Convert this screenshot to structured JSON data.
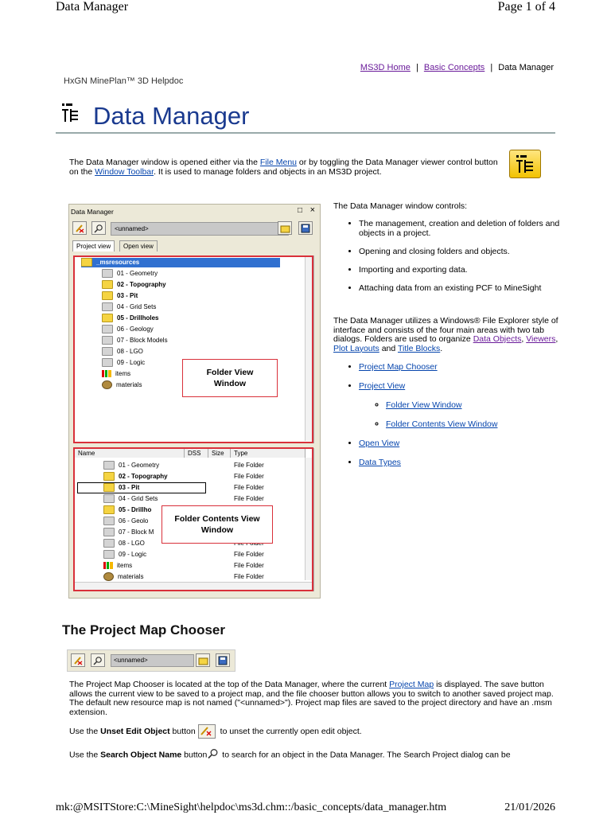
{
  "print": {
    "title": "Data Manager",
    "page": "Page 1 of 4",
    "footer_path": "mk:@MSITStore:C:\\MineSight\\helpdoc\\ms3d.chm::/basic_concepts/data_manager.htm",
    "footer_date": "21/01/2026"
  },
  "breadcrumb": {
    "home": "MS3D Home",
    "sep": "|",
    "basic": "Basic Concepts",
    "current": "Data Manager"
  },
  "helpdoc_title": "HxGN MinePlan™ 3D Helpdoc",
  "page_title": "Data Manager",
  "intro": {
    "t1": "The Data Manager window is opened either via the ",
    "file_menu": "File Menu",
    "t2": " or by toggling the Data Manager viewer control button on the ",
    "window_toolbar": "Window Toolbar",
    "t3": ".  It is used to manage folders and objects in an MS3D project."
  },
  "dm_window": {
    "title": "Data Manager",
    "combo": "<unnamed>",
    "tabs": [
      "Project view",
      "Open view"
    ],
    "tree": [
      {
        "label": "_msresources",
        "bold": true,
        "color": "y",
        "selected": true
      },
      {
        "label": "01 - Geometry",
        "bold": false,
        "color": "g"
      },
      {
        "label": "02 - Topography",
        "bold": true,
        "color": "y"
      },
      {
        "label": "03 - Pit",
        "bold": true,
        "color": "y"
      },
      {
        "label": "04 - Grid Sets",
        "bold": false,
        "color": "g"
      },
      {
        "label": "05 - Drillholes",
        "bold": true,
        "color": "y"
      },
      {
        "label": "06 - Geology",
        "bold": false,
        "color": "g"
      },
      {
        "label": "07 - Block Models",
        "bold": false,
        "color": "g"
      },
      {
        "label": "08 - LGO",
        "bold": false,
        "color": "g"
      },
      {
        "label": "09 - Logic",
        "bold": false,
        "color": "g"
      },
      {
        "label": "items",
        "bold": false,
        "color": "chart"
      },
      {
        "label": "materials",
        "bold": false,
        "color": "mat"
      }
    ],
    "folder_view_callout": "Folder View Window",
    "columns": [
      "Name",
      "DSS",
      "Size",
      "Type"
    ],
    "contents": [
      {
        "name": "01 - Geometry",
        "type": "File Folder",
        "bold": false,
        "color": "g"
      },
      {
        "name": "02 - Topography",
        "type": "File Folder",
        "bold": true,
        "color": "y"
      },
      {
        "name": "03 - Pit",
        "type": "File Folder",
        "bold": true,
        "color": "y"
      },
      {
        "name": "04 - Grid Sets",
        "type": "File Folder",
        "bold": false,
        "color": "g"
      },
      {
        "name": "05 - Drillho",
        "type": "File Folder",
        "bold": true,
        "color": "y"
      },
      {
        "name": "06 - Geolo",
        "type": "File Folder",
        "bold": false,
        "color": "g"
      },
      {
        "name": "07 - Block M",
        "type": "File Folder",
        "bold": false,
        "color": "g"
      },
      {
        "name": "08 - LGO",
        "type": "File Folder",
        "bold": false,
        "color": "g"
      },
      {
        "name": "09 - Logic",
        "type": "File Folder",
        "bold": false,
        "color": "g"
      },
      {
        "name": "items",
        "type": "File Folder",
        "bold": false,
        "color": "chart"
      },
      {
        "name": "materials",
        "type": "File Folder",
        "bold": false,
        "color": "mat"
      }
    ],
    "folder_contents_callout": "Folder Contents View Window"
  },
  "controls": {
    "heading": "The Data Manager window controls:",
    "items": [
      "The management, creation and deletion of folders and objects in a project.",
      "Opening and closing folders and objects.",
      "Importing and exporting data.",
      "Attaching data from an existing PCF to MineSight"
    ]
  },
  "desc2": {
    "t1": "The Data Manager utilizes a Windows® File Explorer style of interface and consists of the four main areas with two tab dialogs.  Folders are used to organize ",
    "data_objects": "Data Objects",
    "comma": ", ",
    "viewers": "Viewers",
    "comma2": ", ",
    "plot_layouts": "Plot Layouts",
    "and": " and ",
    "title_blocks": "Title Blocks",
    "dot": "."
  },
  "nav": {
    "project_map_chooser": "Project Map Chooser",
    "project_view": "Project View",
    "folder_view_window": "Folder View Window",
    "folder_contents_view_window": "Folder Contents View Window",
    "open_view": "Open View",
    "data_types": "Data Types"
  },
  "section": {
    "heading": "The Project Map Chooser",
    "combo": "<unnamed>",
    "para_t1": "The Project Map Chooser is located at the top of the Data Manager, where the current ",
    "project_map": "Project Map",
    "para_t2": " is displayed. The save button allows the current view to be saved to a project map, and the file chooser button allows you to switch to another saved project map. The default new resource map is not named (\"<unnamed>\").  Project map files are saved to the project directory and have an .msm extension.",
    "use1_pre": "Use the ",
    "use1_bold": "Unset Edit Object",
    "use1_mid": " button",
    "use1_post": " to unset the currently open edit object.",
    "use2_pre": "Use the ",
    "use2_bold": "Search Object Name",
    "use2_mid": " button",
    "use2_post": " to search for an object in the Data Manager. The Search Project dialog can be"
  },
  "colors": {
    "title_blue": "#1a3a8f",
    "link": "#0645ad",
    "visited": "#6a1b9a",
    "callout_red": "#d9303a",
    "selection": "#3070d0"
  }
}
